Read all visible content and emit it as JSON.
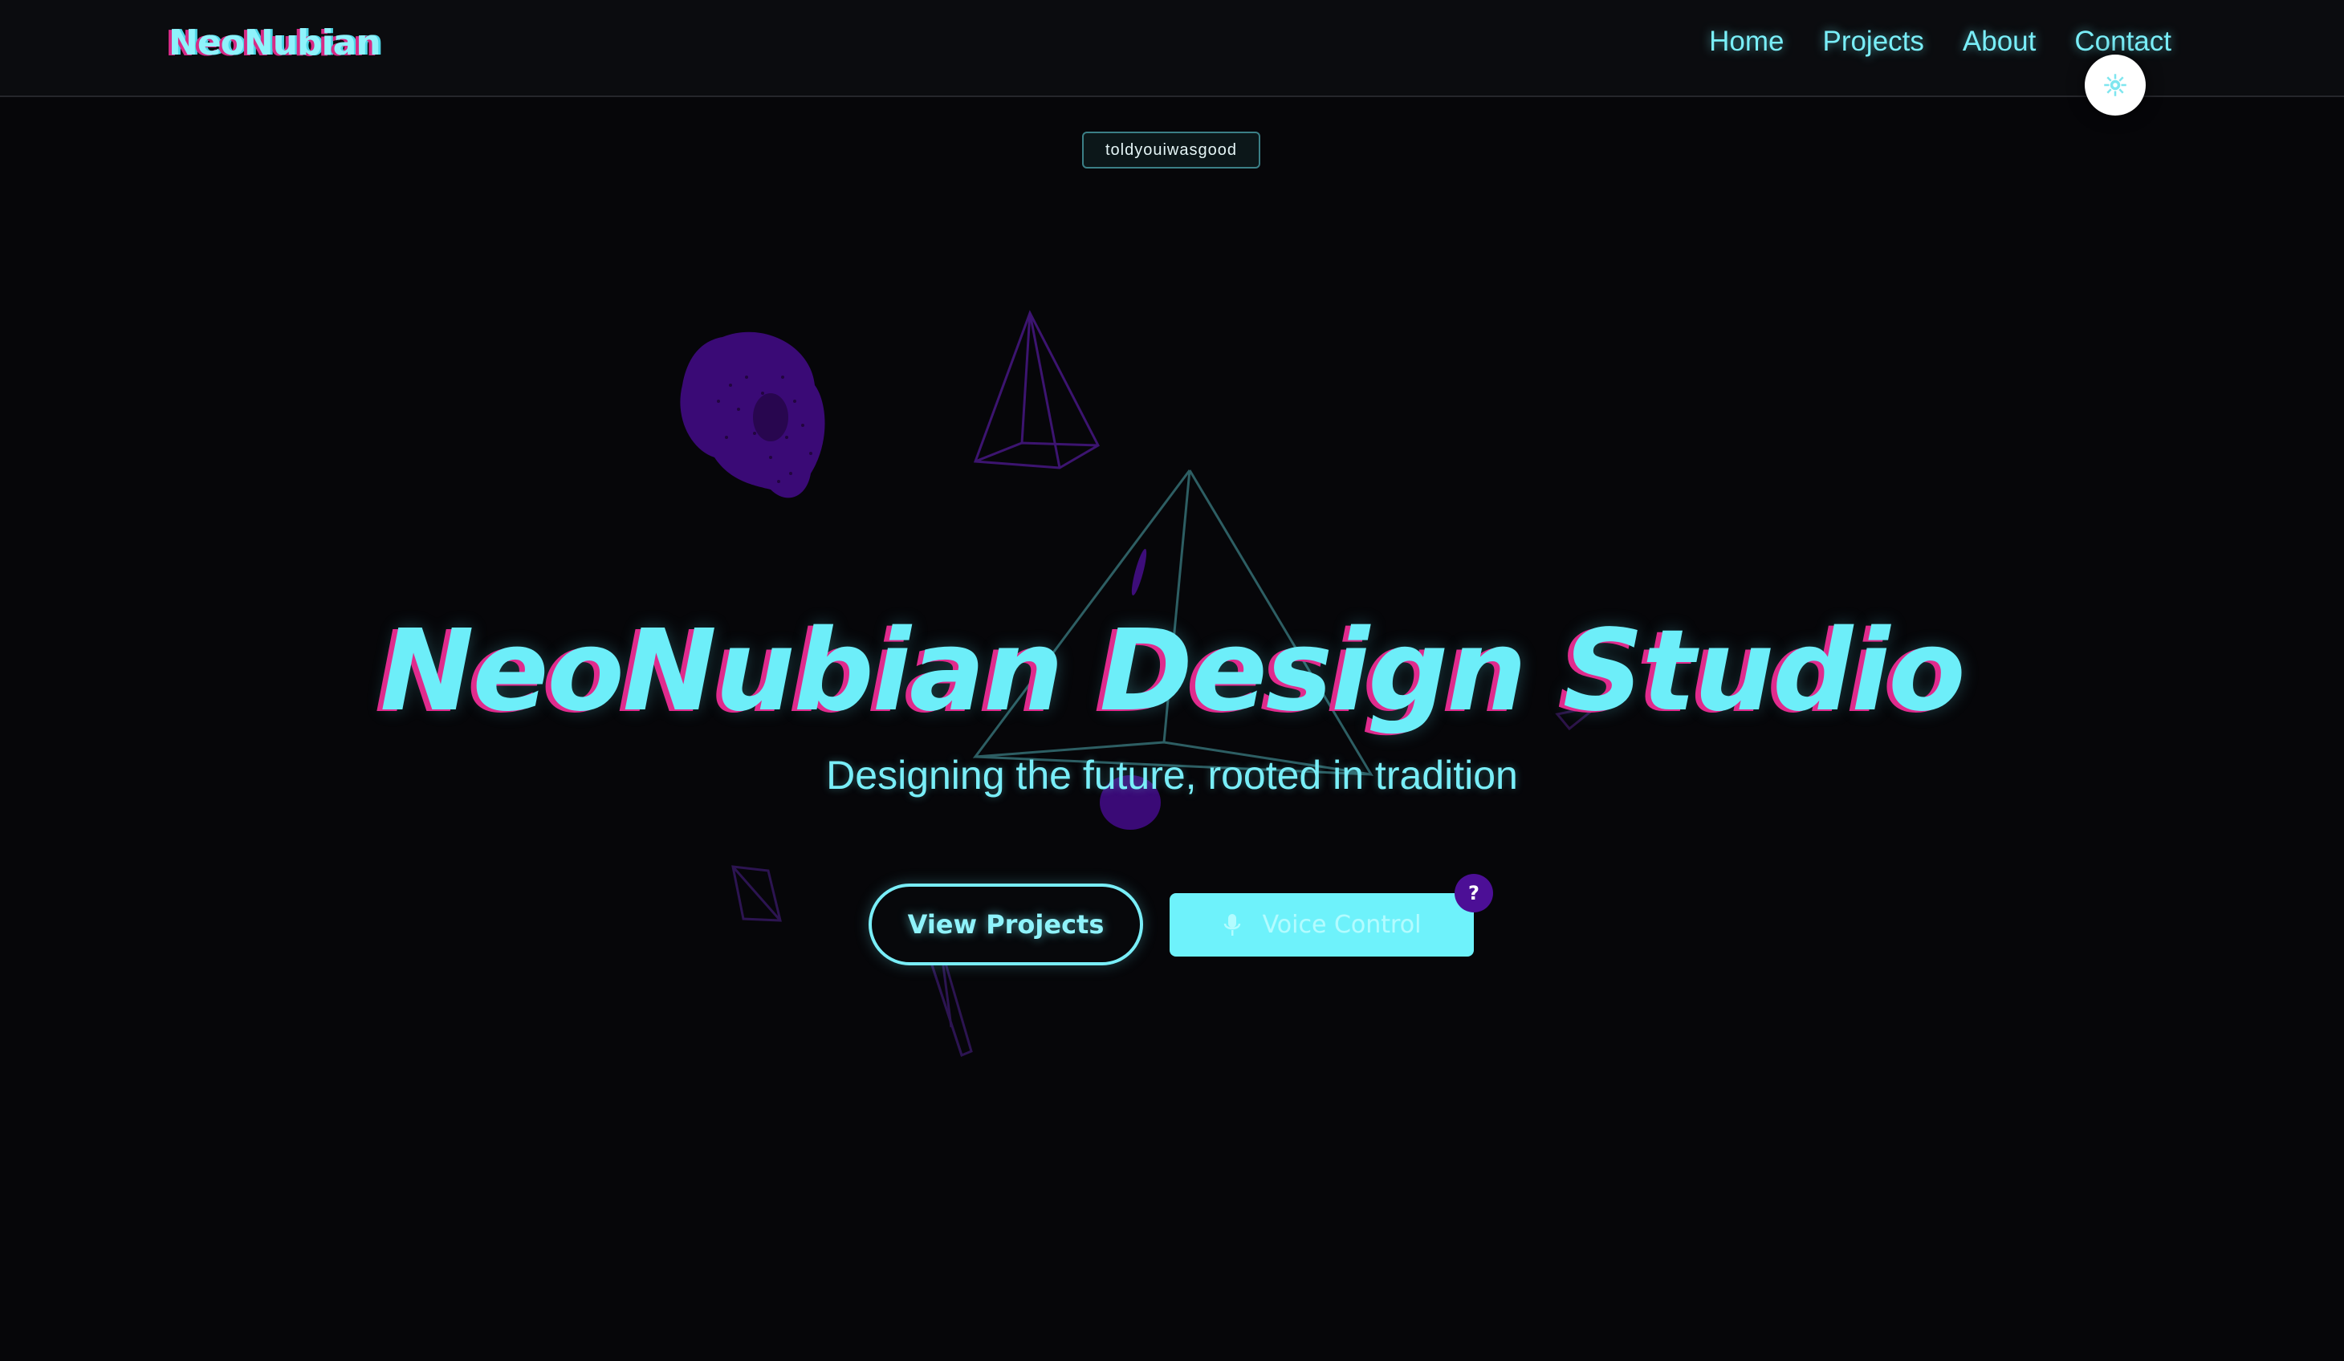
{
  "brand": {
    "logo_text": "NeoNubian"
  },
  "nav": {
    "links": [
      {
        "label": "Home"
      },
      {
        "label": "Projects"
      },
      {
        "label": "About"
      },
      {
        "label": "Contact"
      }
    ]
  },
  "theme_toggle": {
    "icon": "gear-icon"
  },
  "badge": {
    "text": "toldyouiwasgood"
  },
  "hero": {
    "title": "NeoNubian Design Studio",
    "subtitle": "Designing the future, rooted in tradition",
    "primary_button": "View Projects",
    "voice_button": "Voice Control",
    "voice_icon": "microphone-icon",
    "help_badge": "?"
  },
  "colors": {
    "background": "#060609",
    "accent_cyan": "#6deef9",
    "accent_magenta": "#e02b8d",
    "accent_purple": "#4c0f96"
  }
}
